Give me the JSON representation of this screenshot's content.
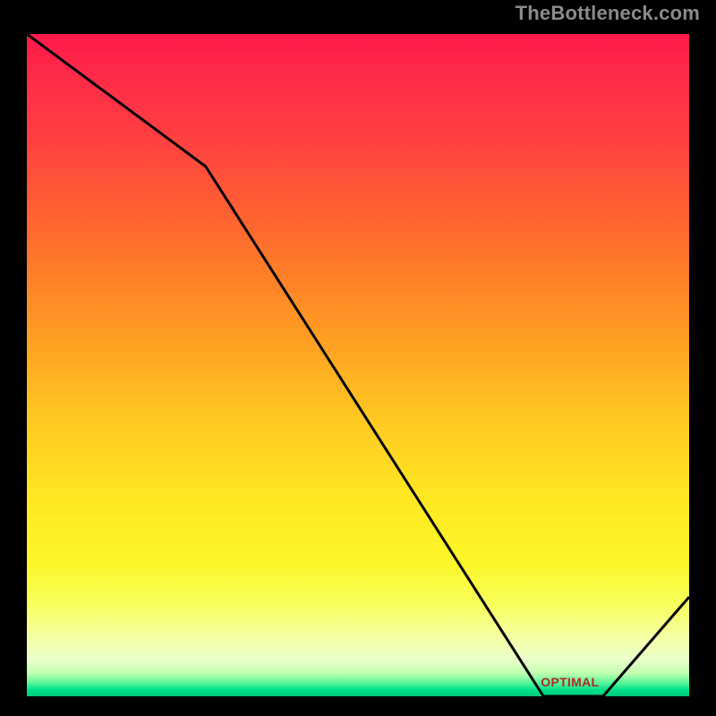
{
  "attribution": "TheBottleneck.com",
  "chart_data": {
    "type": "line",
    "title": "",
    "xlabel": "",
    "ylabel": "",
    "xlim": [
      0,
      100
    ],
    "ylim": [
      0,
      100
    ],
    "grid": false,
    "legend": false,
    "series": [
      {
        "name": "bottleneck-curve",
        "x": [
          0,
          27,
          78,
          87,
          100
        ],
        "y": [
          100,
          80,
          0,
          0,
          15
        ]
      }
    ],
    "annotations": [
      {
        "text": "OPTIMAL",
        "x": 82,
        "y": 1.5
      }
    ],
    "background_gradient": {
      "orientation": "vertical",
      "stops": [
        {
          "pos": 0,
          "color": "#ff1a4b"
        },
        {
          "pos": 0.3,
          "color": "#ff6a2e"
        },
        {
          "pos": 0.58,
          "color": "#ffc822"
        },
        {
          "pos": 0.8,
          "color": "#fbf62a"
        },
        {
          "pos": 0.96,
          "color": "#c0ffb0"
        },
        {
          "pos": 1.0,
          "color": "#00c87a"
        }
      ]
    }
  }
}
